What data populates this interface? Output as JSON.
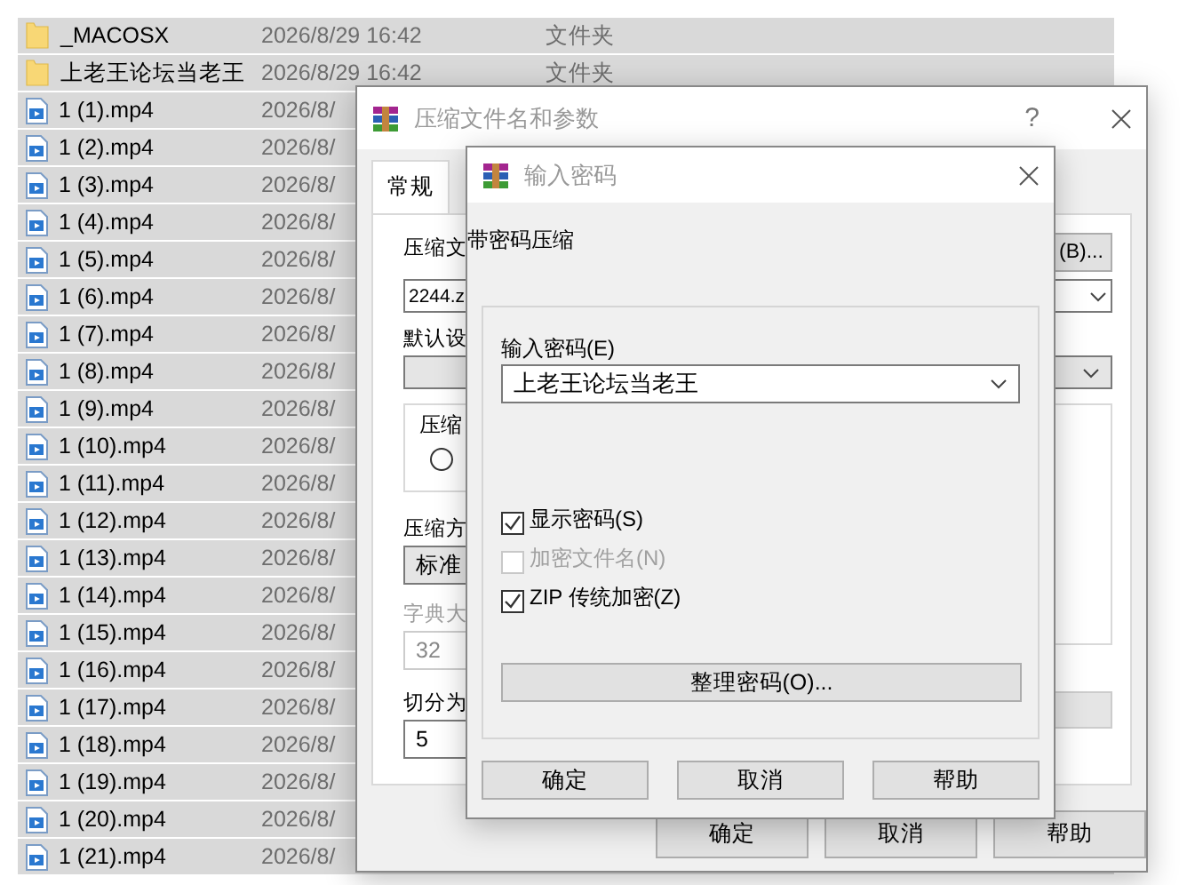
{
  "files": [
    {
      "name": "_MACOSX",
      "date": "2026/8/29 16:42",
      "type": "文件夹",
      "kind": "folder",
      "selected": true
    },
    {
      "name": "上老王论坛当老王",
      "date": "2026/8/29 16:42",
      "type": "文件夹",
      "kind": "folder",
      "selected": true
    },
    {
      "name": "1 (1).mp4",
      "date": "2026/8/",
      "kind": "video",
      "selected": true
    },
    {
      "name": "1 (2).mp4",
      "date": "2026/8/",
      "kind": "video",
      "selected": true
    },
    {
      "name": "1 (3).mp4",
      "date": "2026/8/",
      "kind": "video",
      "selected": true
    },
    {
      "name": "1 (4).mp4",
      "date": "2026/8/",
      "kind": "video",
      "selected": true
    },
    {
      "name": "1 (5).mp4",
      "date": "2026/8/",
      "kind": "video",
      "selected": true
    },
    {
      "name": "1 (6).mp4",
      "date": "2026/8/",
      "kind": "video",
      "selected": true
    },
    {
      "name": "1 (7).mp4",
      "date": "2026/8/",
      "kind": "video",
      "selected": true
    },
    {
      "name": "1 (8).mp4",
      "date": "2026/8/",
      "kind": "video",
      "selected": true
    },
    {
      "name": "1 (9).mp4",
      "date": "2026/8/",
      "kind": "video",
      "selected": true
    },
    {
      "name": "1 (10).mp4",
      "date": "2026/8/",
      "kind": "video",
      "selected": true
    },
    {
      "name": "1 (11).mp4",
      "date": "2026/8/",
      "kind": "video",
      "selected": true
    },
    {
      "name": "1 (12).mp4",
      "date": "2026/8/",
      "kind": "video",
      "selected": true
    },
    {
      "name": "1 (13).mp4",
      "date": "2026/8/",
      "kind": "video",
      "selected": true
    },
    {
      "name": "1 (14).mp4",
      "date": "2026/8/",
      "kind": "video",
      "selected": true
    },
    {
      "name": "1 (15).mp4",
      "date": "2026/8/",
      "kind": "video",
      "selected": true
    },
    {
      "name": "1 (16).mp4",
      "date": "2026/8/",
      "kind": "video",
      "selected": true
    },
    {
      "name": "1 (17).mp4",
      "date": "2026/8/",
      "kind": "video",
      "selected": true
    },
    {
      "name": "1 (18).mp4",
      "date": "2026/8/",
      "kind": "video",
      "selected": true
    },
    {
      "name": "1 (19).mp4",
      "date": "2026/8/",
      "kind": "video",
      "selected": true
    },
    {
      "name": "1 (20).mp4",
      "date": "2026/8/",
      "kind": "video",
      "selected": true
    },
    {
      "name": "1 (21).mp4",
      "date": "2026/8/",
      "kind": "video",
      "selected": true
    }
  ],
  "archive_dialog": {
    "title": "压缩文件名和参数",
    "help": "?",
    "tabs": [
      {
        "label": "常规",
        "selected": true
      }
    ],
    "archive_label": "压缩文",
    "browse_button": "(B)...",
    "archive_name": "2244.z",
    "profile_label": "默认设",
    "format_group": "压缩",
    "format_radio": {
      "selected": false
    },
    "method_label": "压缩方",
    "method_value": "标准",
    "dictionary_label": "字典大",
    "dictionary_value": "32",
    "dictionary_disabled": true,
    "split_label": "切分为",
    "split_value": "5",
    "buttons": [
      "确定",
      "取消",
      "帮助"
    ]
  },
  "password_dialog": {
    "title": "输入密码",
    "heading": "带密码压缩",
    "password_label": "输入密码(E)",
    "password_value": "上老王论坛当老王",
    "options": [
      {
        "label": "显示密码(S)",
        "checked": true,
        "disabled": false
      },
      {
        "label": "加密文件名(N)",
        "checked": false,
        "disabled": true
      },
      {
        "label": "ZIP 传统加密(Z)",
        "checked": true,
        "disabled": false
      }
    ],
    "organize_button": "整理密码(O)...",
    "buttons": [
      "确定",
      "取消",
      "帮助"
    ]
  }
}
